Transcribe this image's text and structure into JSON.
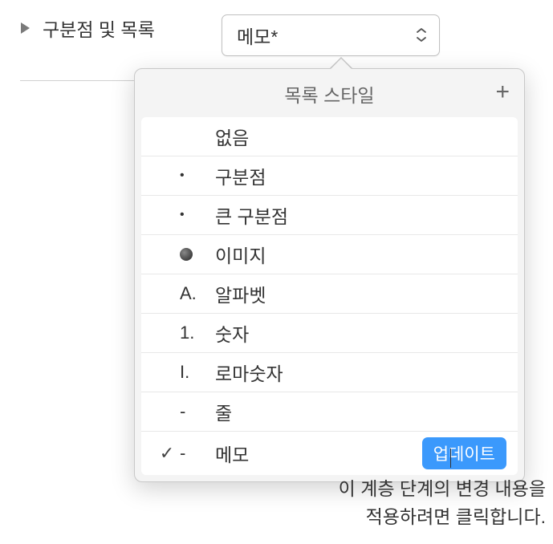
{
  "section": {
    "label": "구분점 및 목록"
  },
  "dropdown": {
    "selected": "메모*"
  },
  "popover": {
    "title": "목록 스타일",
    "add_label": "+",
    "items": [
      {
        "marker": "",
        "label": "없음",
        "checked": false
      },
      {
        "marker": "•",
        "label": "구분점",
        "checked": false
      },
      {
        "marker": "•",
        "label": "큰 구분점",
        "checked": false
      },
      {
        "marker": "img",
        "label": "이미지",
        "checked": false
      },
      {
        "marker": "A.",
        "label": "알파벳",
        "checked": false
      },
      {
        "marker": "1.",
        "label": "숫자",
        "checked": false
      },
      {
        "marker": "I.",
        "label": "로마숫자",
        "checked": false
      },
      {
        "marker": "-",
        "label": "줄",
        "checked": false
      },
      {
        "marker": "-",
        "label": "메모",
        "checked": true,
        "update": true
      }
    ],
    "update_label": "업데이트"
  },
  "callout": {
    "line1": "이 계층 단계의 변경 내용을",
    "line2": "적용하려면 클릭합니다."
  }
}
